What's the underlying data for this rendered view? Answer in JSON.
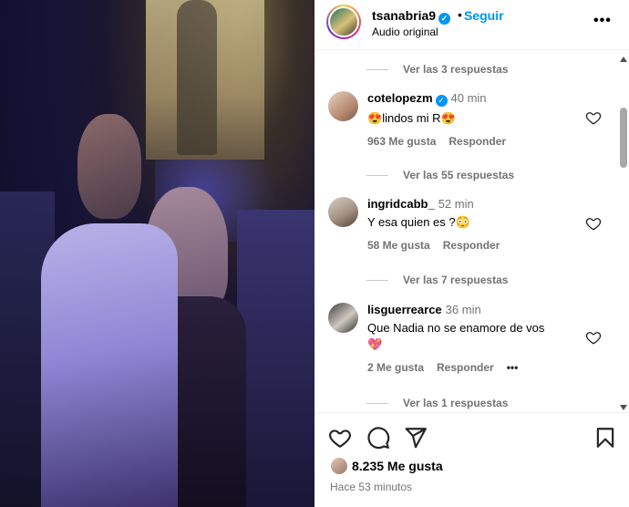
{
  "post": {
    "username": "tsanabria9",
    "separator": "•",
    "follow_label": "Seguir",
    "audio": "Audio original",
    "more_label": "•••"
  },
  "comments": {
    "replies_1": "Ver las 3 respuestas",
    "items": [
      {
        "user": "cotelopezm",
        "verified": true,
        "time": "40 min",
        "text_prefix": "😍",
        "text": "lindos mi R",
        "text_suffix": "😍",
        "likes": "963 Me gusta",
        "reply": "Responder",
        "replies": "Ver las 55 respuestas"
      },
      {
        "user": "ingridcabb_",
        "verified": false,
        "time": "52 min",
        "text": "Y esa quien es ?",
        "text_suffix": "😳",
        "likes": "58 Me gusta",
        "reply": "Responder",
        "replies": "Ver las 7 respuestas"
      },
      {
        "user": "lisguerrearce",
        "verified": false,
        "time": "36 min",
        "text": "Que Nadia no se enamore de vos",
        "text_line2": "💖",
        "likes": "2 Me gusta",
        "reply": "Responder",
        "more": "•••",
        "replies": "Ver las 1 respuestas"
      }
    ]
  },
  "footer": {
    "likes": "8.235 Me gusta",
    "time_ago": "Hace 53 minutos"
  },
  "colors": {
    "accent": "#0095f6",
    "muted": "#737373",
    "heart": "#ee2a5a"
  },
  "icons": [
    "heart-icon",
    "comment-icon",
    "share-icon",
    "bookmark-icon",
    "more-icon",
    "verified-icon"
  ]
}
